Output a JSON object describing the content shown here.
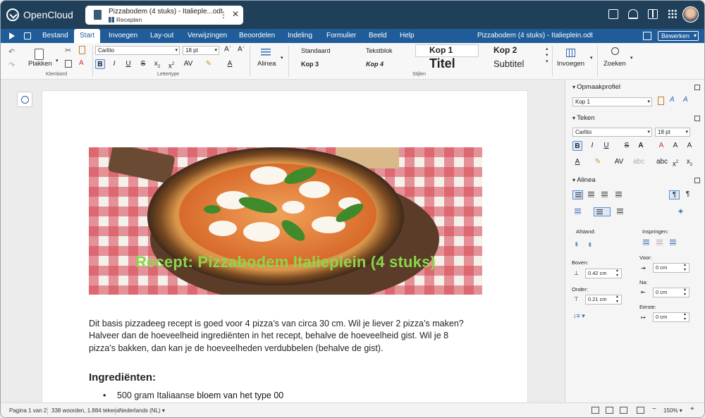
{
  "app": {
    "name": "OpenCloud"
  },
  "file_tab": {
    "title": "Pizzabodem (4 stuks) - Italieple...odt",
    "location": "Recepten"
  },
  "menu": {
    "items": [
      "Bestand",
      "Start",
      "Invoegen",
      "Lay-out",
      "Verwijzingen",
      "Beoordelen",
      "Indeling",
      "Formulier",
      "Beeld",
      "Help"
    ],
    "active": "Start",
    "document_title": "Pizzabodem (4 stuks) - Italieplein.odt",
    "mode_button": "Bewerken"
  },
  "ribbon": {
    "clipboard": {
      "paste_label": "Plakken",
      "group_label": "Klembord"
    },
    "font": {
      "family": "Carlito",
      "size": "18 pt",
      "group_label": "Lettertype"
    },
    "paragraph": {
      "label": "Alinea"
    },
    "styles": {
      "items": [
        "Standaard",
        "Tekstblok",
        "Kop 1",
        "Kop 2",
        "Kop 3",
        "Kop 4",
        "Titel",
        "Subtitel"
      ],
      "group_label": "Stijlen"
    },
    "insert_label": "Invoegen",
    "search_label": "Zoeken"
  },
  "document": {
    "hero_title": "Recept: Pizzabodem Italieplein (4 stuks)",
    "paragraph": "Dit basis pizzadeeg recept is goed voor 4 pizza’s van circa 30 cm. Wil je liever 2 pizza’s maken? Halveer dan de hoeveelheid ingrediënten in het recept, behalve de hoeveelheid gist. Wil je 8 pizza’s bakken, dan kan je de hoeveelheden verdubbelen (behalve de gist).",
    "heading": "Ingrediënten:",
    "list": [
      {
        "normal": "500 gram Italiaanse ",
        "emph": "bloem van het type 00"
      }
    ]
  },
  "sidebar": {
    "style_section": "Opmaakprofiel",
    "style_value": "Kop 1",
    "char_section": "Teken",
    "char_font": "Carlito",
    "char_size": "18 pt",
    "para_section": "Alinea",
    "spacing_label": "Afstand:",
    "indent_label": "Inspringen:",
    "above_label": "Boven:",
    "above_value": "0.42 cm",
    "below_label": "Onder:",
    "below_value": "0.21 cm",
    "before_label": "Voor:",
    "before_value": "0 cm",
    "after_label": "Na:",
    "after_value": "0 cm",
    "first_label": "Eerste:",
    "first_value": "0 cm"
  },
  "status": {
    "page": "Pagina 1 van 2",
    "words": "338 woorden, 1.884 tekens",
    "language": "Nederlands (NL)",
    "zoom": "150%"
  },
  "colors": {
    "topbar": "#20405a",
    "menubar": "#1f5c99",
    "hero_text": "#8bd64a"
  }
}
